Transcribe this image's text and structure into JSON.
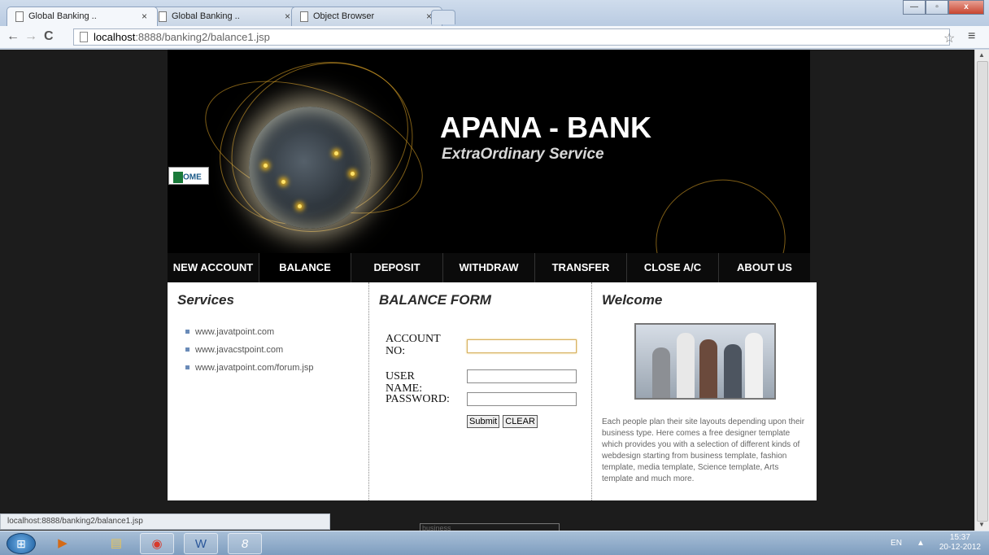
{
  "browser": {
    "tabs": [
      {
        "title": "Global Banking ..",
        "close": "×"
      },
      {
        "title": "Global Banking ..",
        "close": "×"
      },
      {
        "title": "Object Browser",
        "close": "×"
      }
    ],
    "url_host": "localhost",
    "url_rest": ":8888/banking2/balance1.jsp",
    "status_text": "localhost:8888/banking2/balance1.jsp",
    "back": "←",
    "forward": "→",
    "reload": "C",
    "star": "☆",
    "menu": "≡",
    "win_min": "—",
    "win_max": "▫",
    "win_close": "x"
  },
  "site": {
    "title": "APANA - BANK",
    "subtitle": "ExtraOrdinary Service",
    "home_label": "OME",
    "nav": [
      "NEW ACCOUNT",
      "BALANCE",
      "DEPOSIT",
      "WITHDRAW",
      "TRANSFER",
      "CLOSE A/C",
      "ABOUT US"
    ],
    "services": {
      "heading": "Services",
      "links": [
        "www.javatpoint.com",
        "www.javacstpoint.com",
        "www.javatpoint.com/forum.jsp"
      ]
    },
    "form": {
      "heading": "BALANCE FORM",
      "account_label": "ACCOUNT NO:",
      "username_label": "USER NAME:",
      "password_label": "PASSWORD:",
      "submit": "Submit",
      "clear": "CLEAR"
    },
    "welcome": {
      "heading": "Welcome",
      "text": "Each people plan their site layouts depending upon their business type. Here comes a free designer template which provides you with a selection of different kinds of webdesign starting from business template, fashion template, media template, Science template, Arts template and much more."
    },
    "bottom_box": "business"
  },
  "taskbar": {
    "language": "EN",
    "tray_arrow": "▲",
    "time": "15:37",
    "date": "20-12-2012"
  }
}
